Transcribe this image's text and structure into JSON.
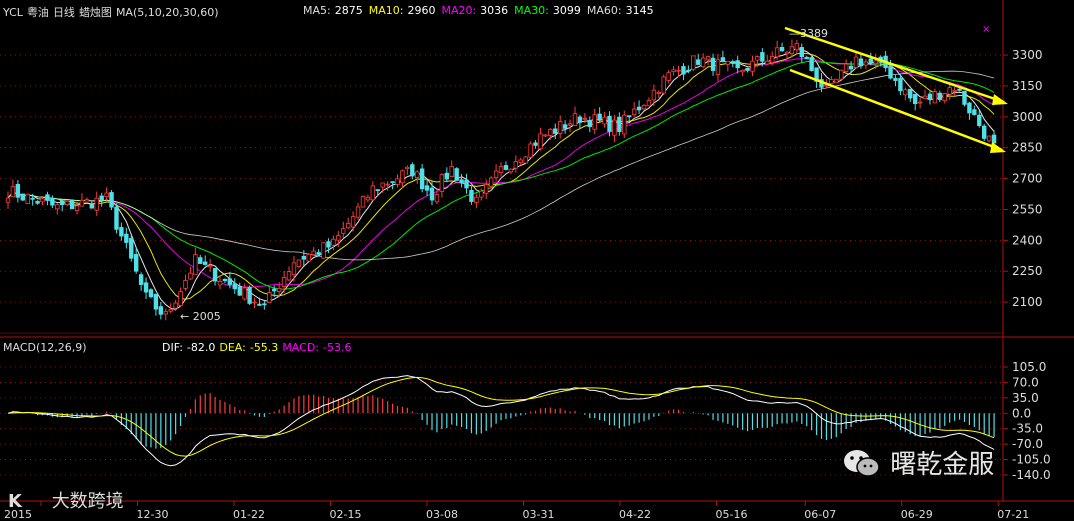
{
  "header": {
    "symbol": "YCL",
    "name": "粤油",
    "period": "日线",
    "style": "蜡烛图",
    "ma_label": "MA(5,10,20,30,60)",
    "ma_values": [
      {
        "label": "MA5:",
        "value": "2875",
        "color": "#ffffff"
      },
      {
        "label": "MA10:",
        "value": "2960",
        "color": "#ffff00"
      },
      {
        "label": "MA20:",
        "value": "3036",
        "color": "#ff00ff"
      },
      {
        "label": "MA30:",
        "value": "3099",
        "color": "#00ff00"
      },
      {
        "label": "MA60:",
        "value": "3145",
        "color": "#ffffff"
      }
    ]
  },
  "macd_header": {
    "label": "MACD(12,26,9)",
    "dif_label": "DIF:",
    "dif": "-82.0",
    "dea_label": "DEA:",
    "dea": "-55.3",
    "macd_label": "MACD:",
    "macd": "-53.6"
  },
  "annotations": {
    "high": "3389",
    "low": "2005"
  },
  "watermarks": {
    "left": "大数跨境",
    "right": "曙乾金服"
  },
  "colors": {
    "up": "#ff3c3c",
    "down": "#4fe0e8",
    "bg": "#000000",
    "axis": "#b01010",
    "trend": "#ffff00"
  },
  "chart_data": [
    {
      "type": "candlestick",
      "title": "YCL 粤油 日线 蜡烛图",
      "yticks": [
        3300,
        3150,
        3000,
        2850,
        2700,
        2550,
        2400,
        2250,
        2100
      ],
      "ylim": [
        1950,
        3480
      ],
      "xticks": [
        "2015",
        "12-30",
        "01-22",
        "02-15",
        "03-08",
        "03-31",
        "04-22",
        "05-16",
        "06-07",
        "06-29",
        "07-21"
      ],
      "close_keypoints": [
        [
          0,
          2640
        ],
        [
          10,
          2560
        ],
        [
          20,
          2600
        ],
        [
          28,
          2120
        ],
        [
          32,
          2030
        ],
        [
          38,
          2300
        ],
        [
          44,
          2200
        ],
        [
          52,
          2080
        ],
        [
          58,
          2300
        ],
        [
          66,
          2380
        ],
        [
          74,
          2650
        ],
        [
          82,
          2740
        ],
        [
          86,
          2620
        ],
        [
          90,
          2750
        ],
        [
          95,
          2580
        ],
        [
          100,
          2740
        ],
        [
          108,
          2900
        ],
        [
          116,
          3000
        ],
        [
          124,
          2950
        ],
        [
          134,
          3200
        ],
        [
          140,
          3280
        ],
        [
          148,
          3220
        ],
        [
          155,
          3300
        ],
        [
          160,
          3340
        ],
        [
          166,
          3120
        ],
        [
          172,
          3280
        ],
        [
          178,
          3240
        ],
        [
          184,
          3060
        ],
        [
          192,
          3150
        ],
        [
          200,
          2850
        ]
      ],
      "moving_averages": [
        "MA5",
        "MA10",
        "MA20",
        "MA30",
        "MA60"
      ],
      "high_label": 3389,
      "low_label": 2005
    },
    {
      "type": "macd",
      "title": "MACD(12,26,9)",
      "yticks": [
        105.0,
        70.0,
        35.0,
        0.0,
        -35.0,
        -70.0,
        -105.0,
        -140.0
      ],
      "ylim": [
        -150,
        150
      ],
      "last": {
        "DIF": -82.0,
        "DEA": -55.3,
        "MACD": -53.6
      }
    }
  ]
}
